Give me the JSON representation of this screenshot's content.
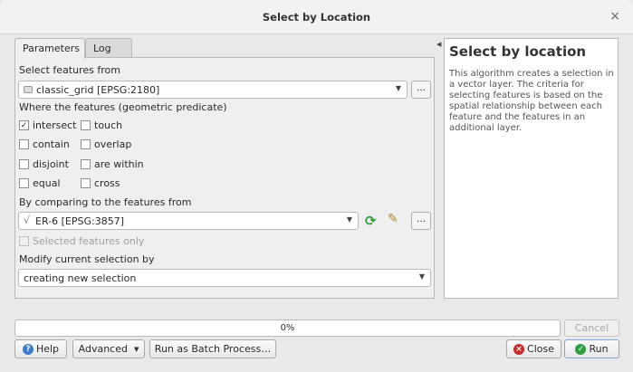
{
  "window": {
    "title": "Select by Location",
    "close_glyph": "×"
  },
  "tabs": [
    {
      "label": "Parameters"
    },
    {
      "label": "Log"
    }
  ],
  "params": {
    "select_from_label": "Select features from",
    "select_from_value": "classic_grid [EPSG:2180]",
    "predicate_label": "Where the features (geometric predicate)",
    "predicates": [
      {
        "label": "intersect",
        "checked": true
      },
      {
        "label": "touch",
        "checked": false
      },
      {
        "label": "contain",
        "checked": false
      },
      {
        "label": "overlap",
        "checked": false
      },
      {
        "label": "disjoint",
        "checked": false
      },
      {
        "label": "are within",
        "checked": false
      },
      {
        "label": "equal",
        "checked": false
      },
      {
        "label": "cross",
        "checked": false
      }
    ],
    "compare_label": "By comparing to the features from",
    "compare_value": "ER-6 [EPSG:3857]",
    "selected_only_label": "Selected features only",
    "modify_label": "Modify current selection by",
    "modify_value": "creating new selection",
    "ellipsis": "…"
  },
  "help": {
    "title": "Select by location",
    "text": "This algorithm creates a selection in a vector layer. The criteria for selecting features is based on the spatial relationship between each feature and the features in an additional layer."
  },
  "progress": {
    "text": "0%",
    "value": 0
  },
  "buttons": {
    "cancel": "Cancel",
    "help": "Help",
    "advanced": "Advanced",
    "batch": "Run as Batch Process…",
    "close": "Close",
    "run": "Run"
  },
  "colors": {
    "help_icon": "#3b7bd4",
    "close_icon": "#c92a2a",
    "run_icon": "#2e9e3e",
    "refresh_icon": "#2e9e3e"
  }
}
